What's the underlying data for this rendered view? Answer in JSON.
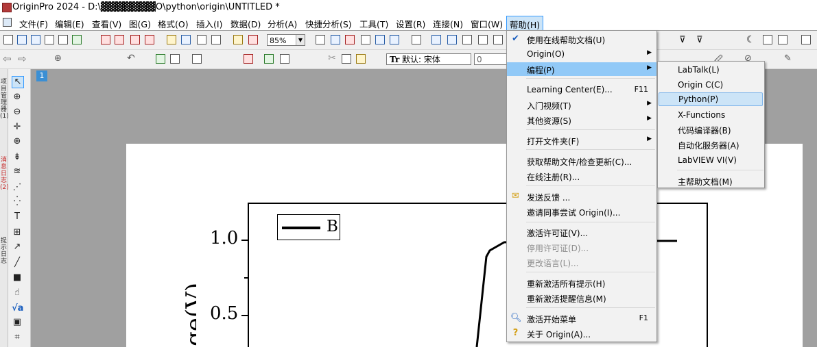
{
  "window": {
    "title": "OriginPro 2024 - D:\\▓▓▓▓▓▓▓▓O\\python\\origin\\UNTITLED *"
  },
  "menubar": [
    "文件(F)",
    "编辑(E)",
    "查看(V)",
    "图(G)",
    "格式(O)",
    "插入(I)",
    "数据(D)",
    "分析(A)",
    "快捷分析(S)",
    "工具(T)",
    "设置(R)",
    "连接(N)",
    "窗口(W)",
    "帮助(H)"
  ],
  "toolbar": {
    "zoom": "85%",
    "font_name": "默认: 宋体",
    "font_size": "0"
  },
  "workbook_window_number": "1",
  "left_panel": {
    "tab_text": "项目管理器 (1)",
    "tab_text2": "消息日志 (2)",
    "tab_text3": "提示日志"
  },
  "graph": {
    "legend": "B",
    "y_axis_title": "ge(V)",
    "y_ticks": [
      "1.0",
      "0.5"
    ]
  },
  "help_menu": {
    "items": [
      {
        "label": "使用在线帮助文档(U)",
        "checked": true
      },
      {
        "label": "Origin(O)",
        "submenu": true
      },
      {
        "label": "编程(P)",
        "submenu": true,
        "highlighted": true
      },
      {
        "label": "Learning Center(E)...",
        "shortcut": "F11"
      },
      {
        "label": "入门视频(T)",
        "submenu": true
      },
      {
        "label": "其他资源(S)",
        "submenu": true
      },
      {
        "label": "打开文件夹(F)",
        "submenu": true
      },
      {
        "label": "获取帮助文件/检查更新(C)..."
      },
      {
        "label": "在线注册(R)..."
      },
      {
        "label": "发送反馈 ...",
        "icon": "envelope-icon"
      },
      {
        "label": "邀请同事尝试 Origin(I)..."
      },
      {
        "label": "激活许可证(V)..."
      },
      {
        "label": "停用许可证(D)...",
        "disabled": true
      },
      {
        "label": "更改语言(L)...",
        "disabled": true
      },
      {
        "label": "重新激活所有提示(H)"
      },
      {
        "label": "重新激活提醒信息(M)"
      },
      {
        "label": "激活开始菜单",
        "shortcut": "F1",
        "icon": "search-icon"
      },
      {
        "label": "关于 Origin(A)...",
        "icon": "help-icon"
      }
    ]
  },
  "programming_submenu": {
    "items": [
      "LabTalk(L)",
      "Origin C(C)",
      "Python(P)",
      "X-Functions",
      "代码编译器(B)",
      "自动化服务器(A)",
      "LabVIEW VI(V)",
      "主帮助文档(M)"
    ],
    "highlighted": "Python(P)"
  }
}
